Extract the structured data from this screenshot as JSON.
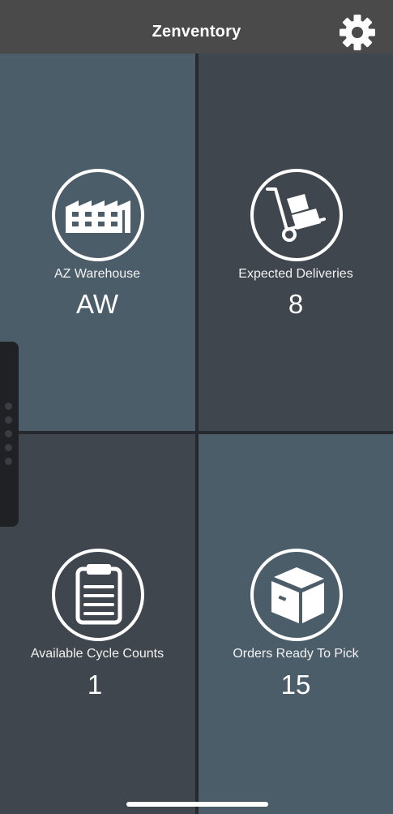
{
  "header": {
    "title": "Zenventory",
    "settings_icon": "gear-icon"
  },
  "tiles": [
    {
      "label": "AZ Warehouse",
      "value": "AW",
      "icon": "warehouse-icon"
    },
    {
      "label": "Expected Deliveries",
      "value": "8",
      "icon": "hand-truck-icon"
    },
    {
      "label": "Available Cycle Counts",
      "value": "1",
      "icon": "clipboard-icon"
    },
    {
      "label": "Orders Ready To Pick",
      "value": "15",
      "icon": "box-icon"
    }
  ],
  "colors": {
    "header_bg": "#4a4a4a",
    "tile_light": "#4c5d6a",
    "tile_dark": "#3f464d",
    "divider": "#262a2e",
    "text": "#ffffff"
  }
}
